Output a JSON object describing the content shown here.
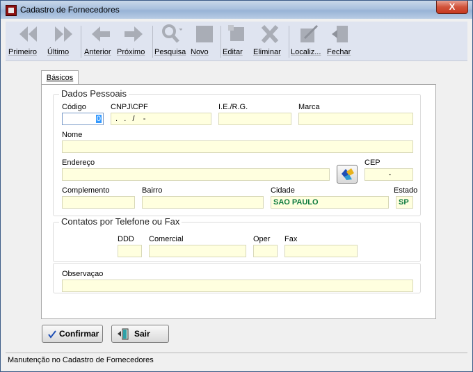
{
  "window": {
    "title": "Cadastro de Fornecedores",
    "close_glyph": "X"
  },
  "toolbar": {
    "first": "Primeiro",
    "last": "Último",
    "previous": "Anterior",
    "next": "Próximo",
    "search": "Pesquisa",
    "new": "Novo",
    "edit": "Editar",
    "delete": "Eliminar",
    "locate": "Localiz...",
    "close": "Fechar"
  },
  "tabs": {
    "basic": "Básicos"
  },
  "personal": {
    "group_title": "Dados Pessoais",
    "code_label": "Código",
    "code_value": "0",
    "cnpj_label": "CNPJ\\CPF",
    "cnpj_mask": " .   .   /    -",
    "ie_label": "I.E./R.G.",
    "ie_value": "",
    "brand_label": "Marca",
    "brand_value": "",
    "name_label": "Nome",
    "name_value": "",
    "address_label": "Endereço",
    "address_value": "",
    "cep_label": "CEP",
    "cep_mask": "-",
    "complement_label": "Complemento",
    "complement_value": "",
    "district_label": "Bairro",
    "district_value": "",
    "city_label": "Cidade",
    "city_value": "SAO PAULO",
    "state_label": "Estado",
    "state_value": "SP"
  },
  "contacts": {
    "group_title": "Contatos por Telefone ou Fax",
    "ddd_label": "DDD",
    "ddd_value": "",
    "commercial_label": "Comercial",
    "commercial_value": "",
    "oper_label": "Oper",
    "oper_value": "",
    "fax_label": "Fax",
    "fax_value": ""
  },
  "notes": {
    "label": "Observaçao",
    "value": ""
  },
  "actions": {
    "confirm": "Confirmar",
    "exit": "Sair"
  },
  "status_bar": {
    "text": "Manutenção no Cadastro de Fornecedores"
  },
  "colors": {
    "field_bg": "#ffffdf",
    "green_text": "#0b7a3e",
    "close_red": "#c7381f",
    "disabled_icon": "#a9adb6"
  }
}
